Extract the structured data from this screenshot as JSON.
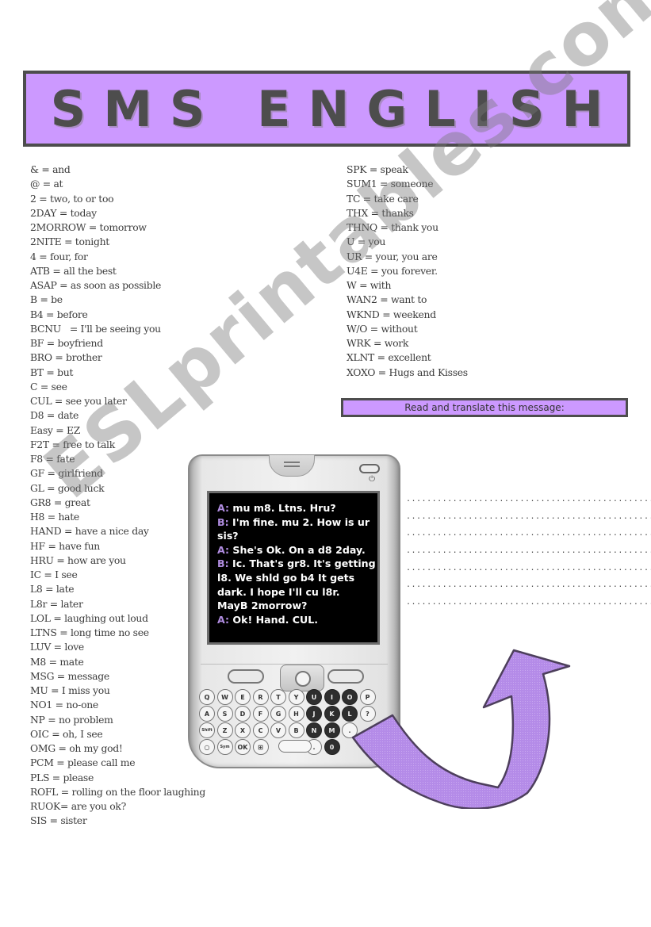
{
  "title": "SMS ENGLISH",
  "glossary_left": [
    "& = and",
    "@ = at",
    "2 = two, to or too",
    "2DAY = today",
    "2MORROW = tomorrow",
    "2NITE = tonight",
    "4 = four, for",
    "ATB = all the best",
    "ASAP = as soon as possible",
    "B = be",
    "B4 = before",
    "BCNU   = I'll be seeing you",
    "BF = boyfriend",
    "BRO = brother",
    "BT = but",
    "C = see",
    "CUL = see you later",
    "D8 = date",
    "Easy = EZ",
    "F2T = free to talk",
    "F8 = fate",
    "GF = girlfriend",
    "GL = good luck",
    "GR8 = great",
    "H8 = hate",
    "HAND = have a nice day",
    "HF = have fun",
    "HRU = how are you",
    "IC = I see",
    "L8 = late",
    "L8r = later",
    "LOL = laughing out loud",
    "LTNS = long time no see",
    "LUV = love",
    "M8 = mate",
    "MSG = message",
    "MU = I miss you",
    "NO1 = no-one",
    "NP = no problem",
    "OIC = oh, I see",
    "OMG = oh my god!",
    "PCM = please call me",
    "PLS = please",
    "ROFL = rolling on the floor laughing",
    "RUOK= are you ok?",
    "SIS = sister"
  ],
  "glossary_right": [
    "SPK = speak",
    "SUM1 = someone",
    "TC = take care",
    "THX = thanks",
    "THNQ = thank you",
    "U = you",
    "UR = your, you are",
    "U4E = you forever.",
    "W = with",
    "WAN2 = want to",
    "WKND = weekend",
    "W/O = without",
    "WRK = work",
    "XLNT = excellent",
    "XOXO = Hugs and Kisses"
  ],
  "instruction": "Read and translate this message:",
  "phone": {
    "power_icon": "power-icon",
    "message_lines": [
      {
        "speaker": "A:",
        "text": "  mu m8. Ltns. Hru?"
      },
      {
        "speaker": "B:",
        "text": "  I'm fine. mu 2. How is ur"
      },
      {
        "speaker": "",
        "text": "sis?"
      },
      {
        "speaker": "A:",
        "text": " She's Ok. On a d8 2day."
      },
      {
        "speaker": "B:",
        "text": " Ic. That's gr8. It's getting"
      },
      {
        "speaker": "",
        "text": "l8. We shld go b4 It gets"
      },
      {
        "speaker": "",
        "text": "dark. I hope I'll cu l8r."
      },
      {
        "speaker": "",
        "text": "MayB 2morrow?"
      },
      {
        "speaker": "A:",
        "text": " Ok! Hand. CUL."
      }
    ],
    "keys": [
      [
        "Q",
        "W",
        "E",
        "R",
        "T",
        "Y",
        "U",
        "I",
        "O",
        "P"
      ],
      [
        "A",
        "S",
        "D",
        "F",
        "G",
        "H",
        "J",
        "K",
        "L",
        "?"
      ],
      [
        "Shift",
        "Z",
        "X",
        "C",
        "V",
        "B",
        "N",
        "M",
        "."
      ],
      [
        "○",
        "Sym",
        "OK",
        "⊞",
        "",
        ".",
        "0"
      ]
    ]
  },
  "answer_line": "..........................................................",
  "answer_line_count": 7,
  "watermark": "ESLprintables.com",
  "colors": {
    "accent_lilac": "#cc99ff",
    "border_gray": "#4d4d4d",
    "speaker_purple": "#b08ce0",
    "arrow_fill": "#b48be8"
  }
}
